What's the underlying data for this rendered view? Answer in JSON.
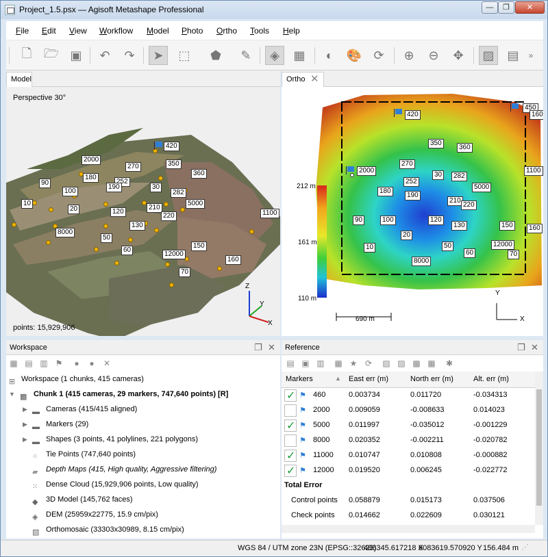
{
  "window": {
    "title": "Project_1.5.psx — Agisoft Metashape Professional",
    "min": "—",
    "max": "❐",
    "close": "✕"
  },
  "menu": [
    "File",
    "Edit",
    "View",
    "Workflow",
    "Model",
    "Photo",
    "Ortho",
    "Tools",
    "Help"
  ],
  "model_panel": {
    "tab": "Model",
    "perspective": "Perspective 30°",
    "points": "points: 15,929,906",
    "axis_x": "X",
    "axis_y": "Y",
    "axis_z": "Z",
    "markers": [
      "420",
      "2000",
      "270",
      "350",
      "180",
      "252",
      "360",
      "90",
      "100",
      "190",
      "30",
      "282",
      "10",
      "20",
      "210",
      "5000",
      "120",
      "220",
      "1100",
      "130",
      "8000",
      "50",
      "150",
      "60",
      "12000",
      "160",
      "70"
    ]
  },
  "ortho_panel": {
    "tab": "Ortho",
    "legend": [
      "212 m",
      "161 m",
      "110 m"
    ],
    "scale": "690 m",
    "axis_x": "X",
    "axis_y": "Y",
    "markers": [
      "450",
      "160",
      "420",
      "350",
      "360",
      "2000",
      "270",
      "1100",
      "30",
      "282",
      "252",
      "5000",
      "180",
      "190",
      "210",
      "220",
      "90",
      "100",
      "120",
      "130",
      "150",
      "160",
      "20",
      "12000",
      "10",
      "50",
      "60",
      "70",
      "8000"
    ]
  },
  "workspace": {
    "title": "Workspace",
    "tree": [
      {
        "text": "Workspace (1 chunks, 415 cameras)",
        "style": "normal"
      },
      {
        "text": "Chunk 1 (415 cameras, 29 markers, 747,640 points) [R]",
        "style": "bold"
      },
      {
        "text": "Cameras (415/415 aligned)",
        "style": "normal"
      },
      {
        "text": "Markers (29)",
        "style": "normal"
      },
      {
        "text": "Shapes (3 points, 41 polylines, 221 polygons)",
        "style": "normal"
      },
      {
        "text": "Tie Points (747,640 points)",
        "style": "normal"
      },
      {
        "text": "Depth Maps (415, High quality, Aggressive filtering)",
        "style": "italic"
      },
      {
        "text": "Dense Cloud (15,929,906 points, Low quality)",
        "style": "normal"
      },
      {
        "text": "3D Model (145,762 faces)",
        "style": "normal"
      },
      {
        "text": "DEM (25959x22775, 15.9 cm/pix)",
        "style": "normal"
      },
      {
        "text": "Orthomosaic (33303x30989, 8.15 cm/pix)",
        "style": "normal"
      }
    ]
  },
  "reference": {
    "title": "Reference",
    "columns": [
      "Markers",
      "East err (m)",
      "North err (m)",
      "Alt. err (m)"
    ],
    "rows": [
      {
        "checked": true,
        "name": "460",
        "east": "0.003734",
        "north": "0.011720",
        "alt": "-0.034313"
      },
      {
        "checked": false,
        "name": "2000",
        "east": "0.009059",
        "north": "-0.008633",
        "alt": "0.014023"
      },
      {
        "checked": true,
        "name": "5000",
        "east": "0.011997",
        "north": "-0.035012",
        "alt": "-0.001229"
      },
      {
        "checked": false,
        "name": "8000",
        "east": "0.020352",
        "north": "-0.002211",
        "alt": "-0.020782"
      },
      {
        "checked": true,
        "name": "11000",
        "east": "0.010747",
        "north": "0.010808",
        "alt": "-0.000882"
      },
      {
        "checked": true,
        "name": "12000",
        "east": "0.019520",
        "north": "0.006245",
        "alt": "-0.022772"
      }
    ],
    "total_error_label": "Total Error",
    "totals": [
      {
        "label": "Control points",
        "east": "0.058879",
        "north": "0.015173",
        "alt": "0.037506"
      },
      {
        "label": "Check points",
        "east": "0.014662",
        "north": "0.022609",
        "alt": "0.030121"
      }
    ]
  },
  "status": {
    "crs": "WGS 84 / UTM zone 23N (EPSG::32623)",
    "x": "486345.617218 X",
    "y": "6083619.570920 Y",
    "z": "156.484 m"
  }
}
